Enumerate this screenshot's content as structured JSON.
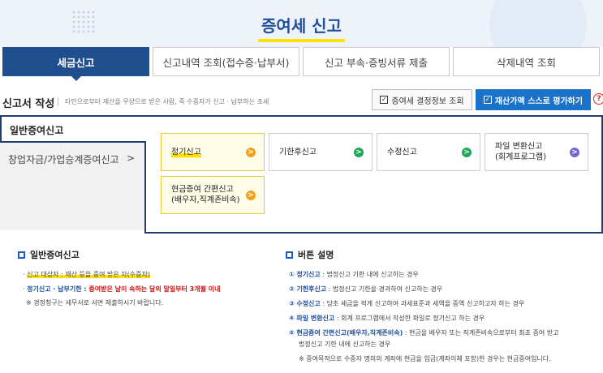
{
  "header": {
    "title": "증여세 신고"
  },
  "tabs": [
    {
      "label": "세금신고",
      "active": true
    },
    {
      "label": "신고내역 조회(접수증·납부서)"
    },
    {
      "label": "신고 부속·증빙서류 제출"
    },
    {
      "label": "삭제내역 조회"
    }
  ],
  "section": {
    "title": "신고서 작성",
    "description": "타인으로부터 재산을 무상으로 받은 사람, 즉 수증자가 신고 · 납부하는 조세",
    "btn_decision": "증여세 결정정보 조회",
    "btn_self_eval": "재산가액 스스로 평가하기",
    "help": "?"
  },
  "sidebar": {
    "items": [
      {
        "label": "일반증여신고"
      },
      {
        "label": "창업자금/가업승계증여신고",
        "chevron": ">"
      }
    ]
  },
  "cards": {
    "regular": "정기신고",
    "after_deadline": "기한후신고",
    "amended": "수정신고",
    "file_conversion_1": "파일 변환신고",
    "file_conversion_2": "(회계프로그램)",
    "cash_simple_1": "현금증여 간편신고",
    "cash_simple_2": "(배우자,직계존비속)",
    "go": ">"
  },
  "info_left": {
    "title": "일반증여신고",
    "line1_key": "신고 대상자 : 재산 등을 증여 받은 자(수증자)",
    "line2_key": "정기신고 · 납부기한 : ",
    "line2_red": "증여받은 날이 속하는 달의 말일부터 3개월 이내",
    "note": "※ 경정청구는 세무서로 서면 제출하시기 바랍니다."
  },
  "info_right": {
    "title": "버튼 설명",
    "items": [
      {
        "num": "①",
        "key": "정기신고",
        "text": " : 법정신고 기한 내에 신고하는 경우"
      },
      {
        "num": "②",
        "key": "기한후신고",
        "text": " : 법정신고 기한을 경과하여 신고하는 경우"
      },
      {
        "num": "③",
        "key": "수정신고",
        "text": " : 당초 세금을 적게 신고하여 과세표준과 세액을 증액 신고하고자 하는 경우"
      },
      {
        "num": "④",
        "key": "파일 변환신고",
        "text": " : 회계 프로그램에서 작성한 파일로 정기신고 하는 경우"
      },
      {
        "num": "⑤",
        "key": "현금증여 간편신고(배우자,직계존비속)",
        "text": " : 현금을 배우자 또는 직계존비속으로부터 최초 증여 받고"
      }
    ],
    "item5_cont": "법정신고 기한 내에 신고하는 경우",
    "note": "※ 증여목적으로 수증자 명의의 계좌에 현금을 입금(계좌이체 포함)한 경우는 현금증여입니다."
  }
}
